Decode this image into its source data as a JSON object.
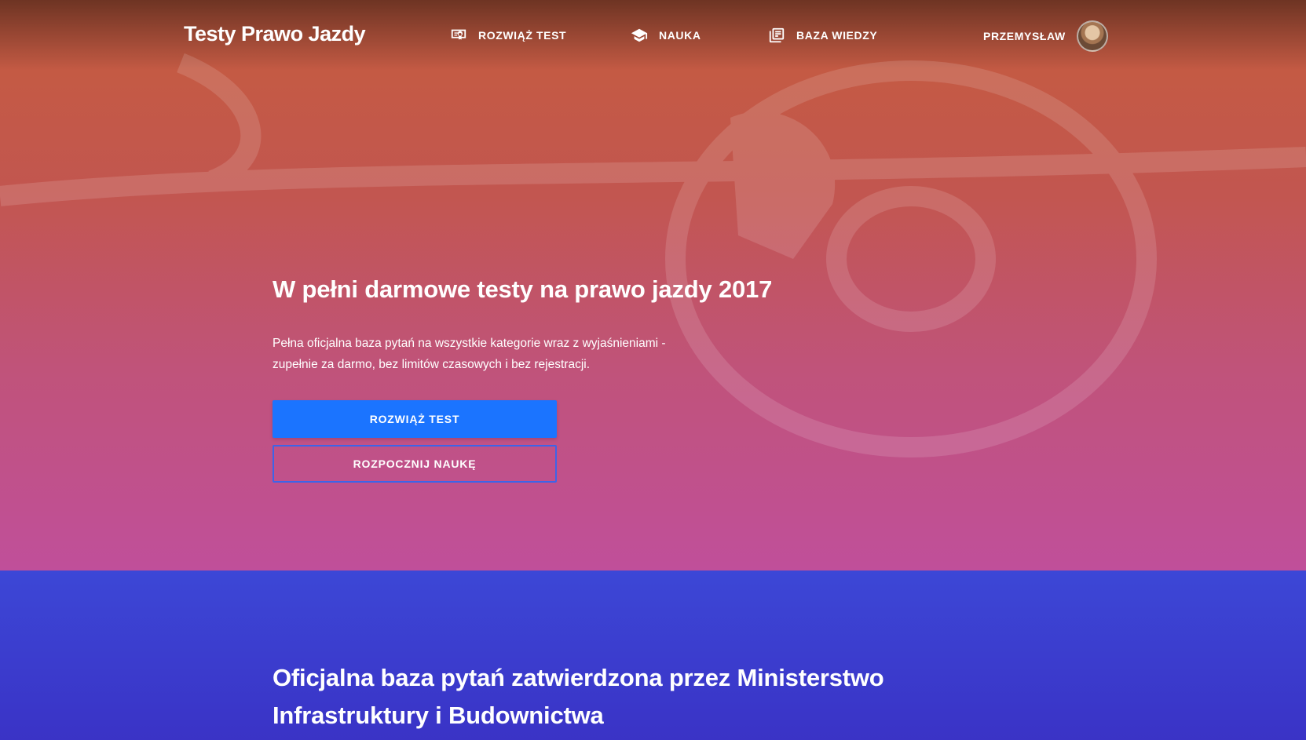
{
  "nav": {
    "brand": "Testy Prawo Jazdy",
    "items": [
      {
        "label": "ROZWIĄŻ TEST",
        "icon": "certificate-icon"
      },
      {
        "label": "NAUKA",
        "icon": "graduation-cap-icon"
      },
      {
        "label": "BAZA WIEDZY",
        "icon": "library-books-icon"
      }
    ],
    "user": {
      "name": "PRZEMYSŁAW",
      "avatar_icon": "user-avatar"
    }
  },
  "hero": {
    "title": "W pełni darmowe testy na prawo jazdy 2017",
    "lead_line1": "Pełna oficjalna baza pytań na wszystkie kategorie wraz z wyjaśnieniami -",
    "lead_line2": "zupełnie za darmo, bez limitów czasowych i bez rejestracji.",
    "primary_button": "ROZWIĄŻ TEST",
    "secondary_button": "ROZPOCZNIJ NAUKĘ"
  },
  "section2": {
    "title_line1": "Oficjalna baza pytań zatwierdzona przez Ministerstwo",
    "title_line2": "Infrastruktury i Budownictwa"
  },
  "colors": {
    "primary": "#1b74ff",
    "outline": "#3d64e8",
    "hero_top": "#c45a44",
    "hero_bottom": "#c04f9a",
    "section2_bg": "#3a33c6"
  }
}
